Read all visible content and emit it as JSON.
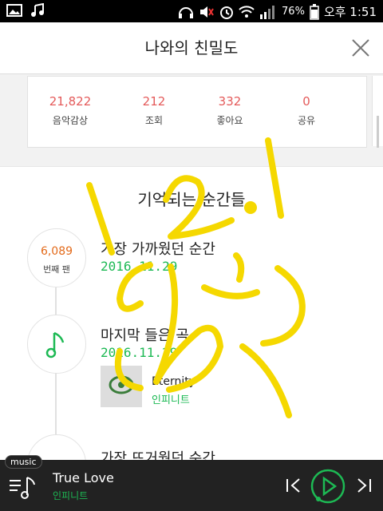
{
  "statusbar": {
    "battery": "76%",
    "time": "오후 1:51"
  },
  "header": {
    "title": "나와의 친밀도"
  },
  "stats": [
    {
      "value": "21,822",
      "label": "음악감상"
    },
    {
      "value": "212",
      "label": "조회"
    },
    {
      "value": "332",
      "label": "좋아요"
    },
    {
      "value": "0",
      "label": "공유"
    }
  ],
  "memories": {
    "title": "기억되는 순간들",
    "items": [
      {
        "badge_number": "6,089",
        "badge_label": "번째 팬",
        "title": "가장 가까웠던 순간",
        "date": "2016.11.29"
      },
      {
        "title": "마지막 들은 곡",
        "date": "2016.11.29",
        "song": {
          "title": "Eternity",
          "artist": "인피니트"
        }
      },
      {
        "title": "가장 뜨거웠던 순간"
      }
    ]
  },
  "player": {
    "tag": "music",
    "title": "True Love",
    "artist": "인피니트"
  },
  "colors": {
    "accent": "#1db954",
    "stat": "#e45a5a",
    "fan_count": "#e36a1a",
    "annotation": "#f5d800"
  }
}
